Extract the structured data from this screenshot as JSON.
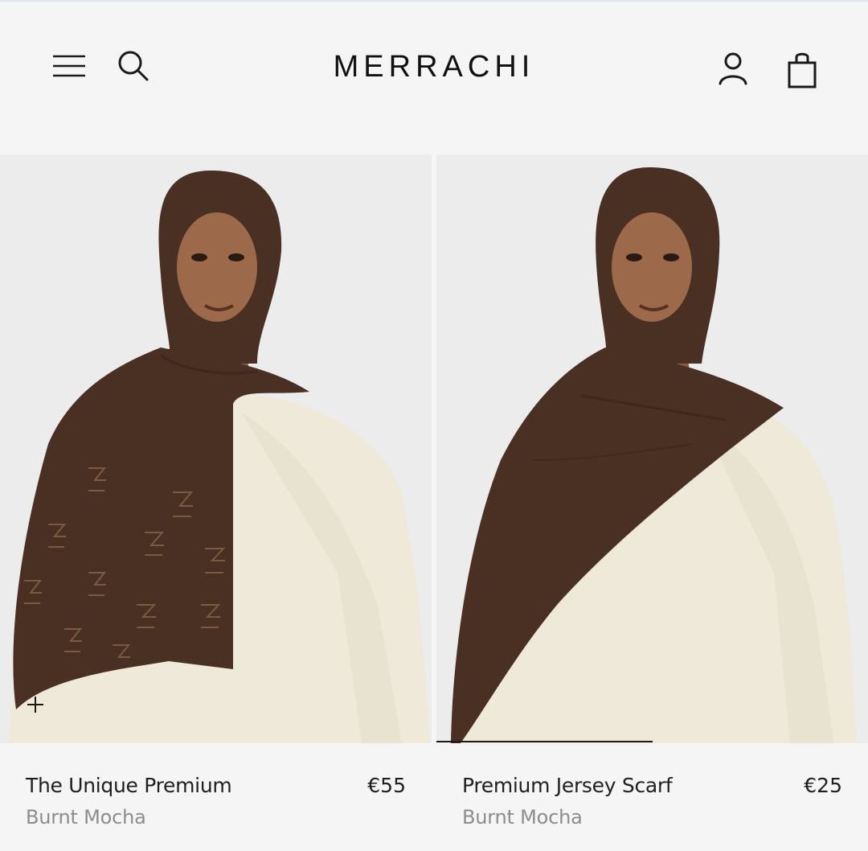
{
  "header": {
    "logo": "MERRACHI",
    "icons": {
      "menu": "hamburger-menu-icon",
      "search": "search-icon",
      "account": "user-icon",
      "bag": "shopping-bag-icon"
    }
  },
  "products": [
    {
      "name": "The Unique Premium",
      "price": "€55",
      "color": "Burnt Mocha",
      "quick_add": "+"
    },
    {
      "name": "Premium Jersey Scarf",
      "price": "€25",
      "color": "Burnt Mocha",
      "carousel_progress": 0.5
    }
  ],
  "colors": {
    "background": "#f5f5f5",
    "scarf": "#4a2f23",
    "dress": "#efe9da",
    "muted_text": "#8c8c8c"
  }
}
